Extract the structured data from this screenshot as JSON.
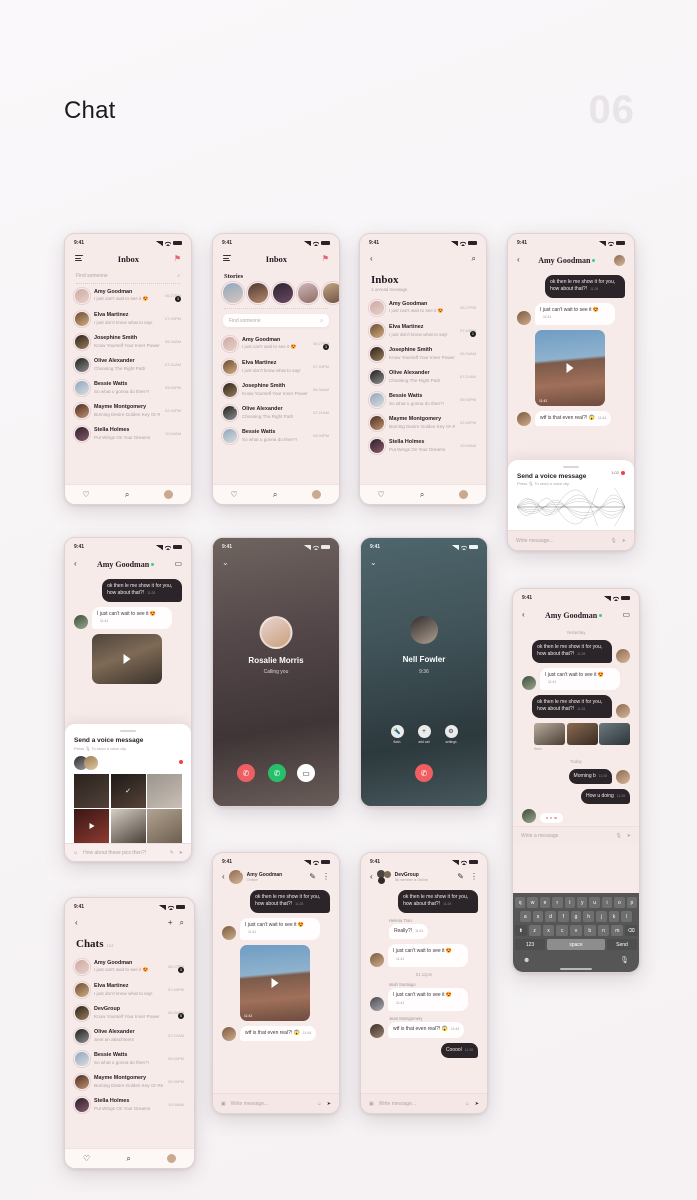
{
  "page": {
    "title": "Chat",
    "number": "06"
  },
  "status_bar": {
    "time": "9:41"
  },
  "icons": {
    "menu": "hamburger-icon",
    "flag": "⚑",
    "search": "search-icon",
    "back": "‹",
    "heart": "♡",
    "plus": "+",
    "video": "▭",
    "more": "⋮",
    "pencil": "✎",
    "camera": "▣",
    "mic": "🎙",
    "send": "➤",
    "emoji": "☺"
  },
  "screen1": {
    "nav_title": "Inbox",
    "search_placeholder": "Find someone",
    "rows": [
      {
        "name": "Amy Goodman",
        "preview": "I just can't wait to see it 😍",
        "time": "06:27PM",
        "badge": "3",
        "status": ""
      },
      {
        "name": "Elva Martinez",
        "preview": "I just don't know what to say!",
        "time": "07:43PM",
        "badge": "",
        "status": ""
      },
      {
        "name": "Josephine Smith",
        "preview": "Know Yourself Your Inner Power",
        "time": "06:34AM",
        "badge": "",
        "status": ""
      },
      {
        "name": "Olive Alexander",
        "preview": "Choosing The Right Path",
        "time": "07:21AM",
        "badge": "",
        "status": ""
      },
      {
        "name": "Bessie Watts",
        "preview": "So what u gonna do then?!",
        "time": "05:00PM",
        "badge": "",
        "status": ""
      },
      {
        "name": "Mayme Montgomery",
        "preview": "Burning Desire Golden Key Or Red Herring",
        "time": "02:40PM",
        "badge": "",
        "status": ""
      },
      {
        "name": "Stella Holmes",
        "preview": "Put Wings On Your Dreams",
        "time": "10:04AM",
        "badge": "",
        "status": ""
      }
    ]
  },
  "screen2": {
    "nav_title": "Inbox",
    "stories_title": "Stories",
    "search_placeholder": "Find someone",
    "rows": [
      {
        "name": "Amy Goodman",
        "preview": "I just can't wait to see it 😍",
        "time": "06:27PM",
        "badge": "3",
        "status": "online"
      },
      {
        "name": "Elva Martinez",
        "preview": "I just don't know what to say!",
        "time": "07:43PM",
        "badge": "",
        "status": "online"
      },
      {
        "name": "Josephine Smith",
        "preview": "Know Yourself Your Inner Power",
        "time": "06:34AM",
        "badge": "",
        "status": ""
      },
      {
        "name": "Olive Alexander",
        "preview": "Choosing The Right Path",
        "time": "07:21AM",
        "badge": "",
        "status": "online"
      },
      {
        "name": "Bessie Watts",
        "preview": "So what u gonna do then?!",
        "time": "05:00PM",
        "badge": "",
        "status": ""
      }
    ]
  },
  "screen3": {
    "heading": "Inbox",
    "subheading": "1 unread message",
    "rows": [
      {
        "name": "Amy Goodman",
        "preview": "I just can't wait to see it 😍",
        "time": "06:27PM",
        "badge": "",
        "status": ""
      },
      {
        "name": "Elva Martinez",
        "preview": "I just don't know what to say!",
        "time": "07:43PM",
        "badge": "1",
        "status": ""
      },
      {
        "name": "Josephine Smith",
        "preview": "Know Yourself Your Inner Power",
        "time": "06:34AM",
        "badge": "",
        "status": ""
      },
      {
        "name": "Olive Alexander",
        "preview": "Choosing The Right Path",
        "time": "07:21AM",
        "badge": "",
        "status": "online"
      },
      {
        "name": "Bessie Watts",
        "preview": "So what u gonna do then?!",
        "time": "05:00PM",
        "badge": "",
        "status": ""
      },
      {
        "name": "Mayme Montgomery",
        "preview": "Burning Desire Golden Key Or Red Herring",
        "time": "02:40PM",
        "badge": "",
        "status": "online"
      },
      {
        "name": "Stella Holmes",
        "preview": "Put Wings On Your Dreams",
        "time": "10:04AM",
        "badge": "",
        "status": "online"
      }
    ]
  },
  "screen4": {
    "contact": "Amy Goodman",
    "messages": [
      {
        "dir": "out",
        "text": "ok then le me show it for you, how about that?!",
        "time": "11:28"
      },
      {
        "dir": "in",
        "text": "I just can't wait to see it 😍",
        "time": "11:41"
      },
      {
        "dir": "media",
        "time": "11:42"
      },
      {
        "dir": "in",
        "text": "wtf is that even real?! 😱",
        "time": "11:44"
      }
    ],
    "sheet": {
      "title": "Send a voice message",
      "subtitle": "Press 🎙 To send a voice clip",
      "duration": "1:02"
    },
    "composer_placeholder": "Write message..."
  },
  "screen5": {
    "contact": "Amy Goodman",
    "messages": [
      {
        "dir": "out",
        "text": "ok then le me show it for you, how about that?!",
        "time": "11:28"
      },
      {
        "dir": "in",
        "text": "I just can't wait to see it 😍",
        "time": "11:41"
      }
    ],
    "sheet": {
      "title": "Send a voice message",
      "subtitle": "Press 🎙 To send a voice clip"
    },
    "composer_value": "How about these pics then?!"
  },
  "call_incoming": {
    "name": "Rosalie Morris",
    "sub": "Calling you"
  },
  "call_active": {
    "name": "Nell Fowler",
    "sub": "9:36",
    "buttons": [
      {
        "icon": "🔦",
        "label": "flash"
      },
      {
        "icon": "+",
        "label": "add call"
      },
      {
        "icon": "⚙",
        "label": "settings"
      }
    ]
  },
  "screen_kb": {
    "contact": "Amy Goodman",
    "sep_yesterday": "Yesterday",
    "sep_today": "Today",
    "messages": [
      {
        "dir": "out",
        "text": "ok then le me show it for you, how about that?!",
        "time": "11:28"
      },
      {
        "dir": "in",
        "text": "I just can't wait to see it 😍",
        "time": "11:41"
      },
      {
        "dir": "out",
        "text": "ok then le me show it for you, how about that?!",
        "time": "11:28"
      },
      {
        "dir": "out",
        "text": "Morning b",
        "time": "11:28"
      },
      {
        "dir": "out",
        "text": "How u doing",
        "time": "11:28"
      }
    ],
    "seen_label": "Seen",
    "composer_placeholder": "Write a message",
    "keyboard": {
      "row1": [
        "q",
        "w",
        "e",
        "r",
        "t",
        "y",
        "u",
        "i",
        "o",
        "p"
      ],
      "row2": [
        "a",
        "s",
        "d",
        "f",
        "g",
        "h",
        "j",
        "k",
        "l"
      ],
      "row3": [
        "⬆",
        "z",
        "x",
        "c",
        "v",
        "b",
        "n",
        "m",
        "⌫"
      ],
      "row4": [
        "123",
        "space",
        "Send"
      ]
    }
  },
  "screen_chats": {
    "heading": "Chats",
    "count": "124",
    "rows": [
      {
        "name": "Amy Goodman",
        "preview": "I just can't wait to see it 😍",
        "time": "06:27PM",
        "badge": "3",
        "status": "online"
      },
      {
        "name": "Elva Martinez",
        "preview": "I just don't know what to say!",
        "time": "07:43PM",
        "badge": "",
        "status": ""
      },
      {
        "name": "DevGroup",
        "preview": "Know Yourself Your Inner Power",
        "time": "06:34AM",
        "badge": "5",
        "status": ""
      },
      {
        "name": "Olive Alexander",
        "preview": "Sent an attachment",
        "time": "07:21AM",
        "badge": "",
        "status": ""
      },
      {
        "name": "Bessie Watts",
        "preview": "So what u gonna do then?!",
        "time": "05:00PM",
        "badge": "",
        "status": ""
      },
      {
        "name": "Mayme Montgomery",
        "preview": "Burning Desire Golden Key Or Red Herring",
        "time": "02:40PM",
        "badge": "",
        "status": ""
      },
      {
        "name": "Stella Holmes",
        "preview": "Put Wings On Your Dreams",
        "time": "10:04AM",
        "badge": "",
        "status": ""
      }
    ]
  },
  "screen_dm": {
    "contact": "Amy Goodman",
    "sub": "Online",
    "messages": [
      {
        "dir": "out",
        "text": "ok then le me show it for you, how about that?!",
        "time": "11:28"
      },
      {
        "dir": "in",
        "text": "I just can't wait to see it 😍",
        "time": "11:41"
      },
      {
        "dir": "media",
        "time": "11:42"
      },
      {
        "dir": "in",
        "text": "wtf is that even real?! 😱",
        "time": "11:44"
      }
    ],
    "composer_placeholder": "Write message..."
  },
  "screen_group": {
    "contact": "DevGroup",
    "sub": "36 member is Online",
    "sep": "01:11pm",
    "messages": [
      {
        "dir": "out",
        "sender": "",
        "text": "ok then le me show it for you, how about that?!",
        "time": "11:28"
      },
      {
        "dir": "in",
        "sender": "Helena Tran",
        "text": "Really?!",
        "time": "11:41"
      },
      {
        "dir": "in",
        "sender": "",
        "text": "I just can't wait to see it 😍",
        "time": "11:41"
      },
      {
        "dir": "in",
        "sender": "Isiah Santiago",
        "text": "I just can't wait to see it 😍",
        "time": "11:41"
      },
      {
        "dir": "in",
        "sender": "Jean Montgomery",
        "text": "wtf is that even real?! 😱",
        "time": "11:44"
      },
      {
        "dir": "out",
        "sender": "",
        "text": "Cooool",
        "time": "11:28"
      }
    ],
    "composer_placeholder": "Write message..."
  }
}
